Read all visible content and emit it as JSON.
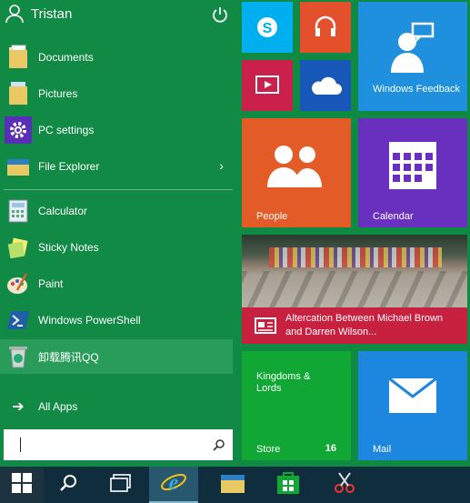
{
  "user": {
    "name": "Tristan"
  },
  "places": [
    {
      "label": "Documents",
      "icon": "folder-documents-icon"
    },
    {
      "label": "Pictures",
      "icon": "folder-pictures-icon"
    },
    {
      "label": "PC settings",
      "icon": "gear-icon"
    },
    {
      "label": "File Explorer",
      "icon": "file-explorer-icon"
    }
  ],
  "apps": [
    {
      "label": "Calculator",
      "icon": "calculator-icon"
    },
    {
      "label": "Sticky Notes",
      "icon": "sticky-notes-icon"
    },
    {
      "label": "Paint",
      "icon": "paint-icon"
    },
    {
      "label": "Windows PowerShell",
      "icon": "powershell-icon"
    },
    {
      "label": "卸载腾讯QQ",
      "icon": "uninstall-qq-icon"
    }
  ],
  "all_apps_label": "All Apps",
  "search": {
    "value": ""
  },
  "tiles": {
    "windows_feedback": {
      "label": "Windows Feedback"
    },
    "people": {
      "label": "People"
    },
    "calendar": {
      "label": "Calendar"
    },
    "news": {
      "headline": "Altercation Between Michael Brown and Darren Wilson..."
    },
    "store": {
      "title": "Kingdoms & Lords",
      "label": "Store",
      "badge": "16"
    },
    "mail": {
      "label": "Mail"
    }
  },
  "colors": {
    "skype": "#00aff0",
    "music": "#e4502c",
    "video": "#cb1f4c",
    "onedrive": "#1657b8",
    "feedback": "#1e90de",
    "people": "#e35b26",
    "calendar": "#6930c0",
    "news_band": "#c8203f",
    "store": "#10a734",
    "mail": "#1d87e0"
  },
  "taskbar": {
    "items": [
      "start-icon",
      "search-icon",
      "task-view-icon",
      "internet-explorer-icon",
      "file-explorer-icon",
      "store-icon",
      "snipping-tool-icon"
    ]
  }
}
